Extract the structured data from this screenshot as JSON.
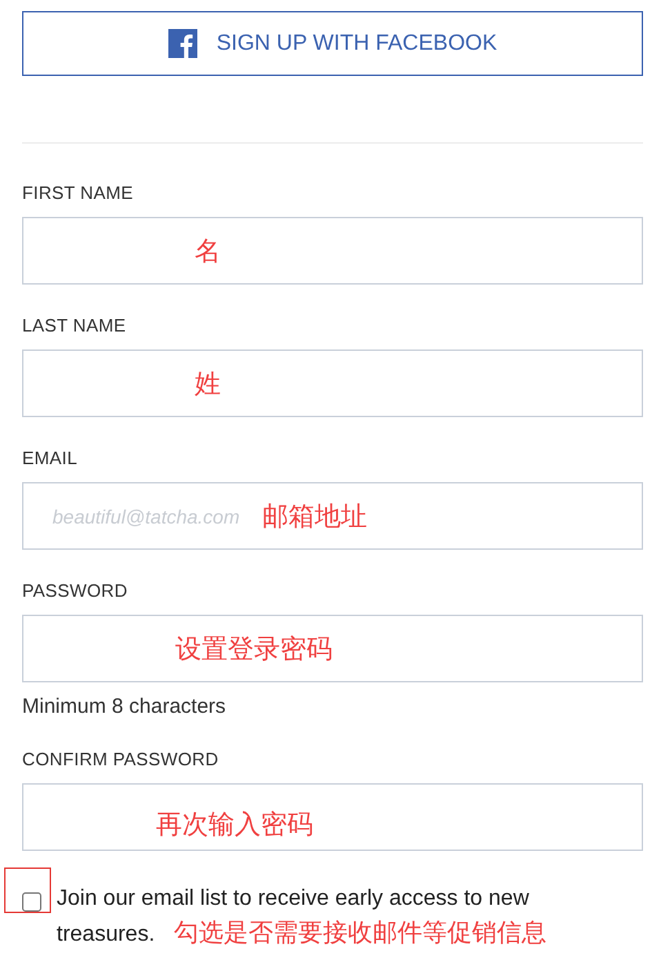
{
  "facebook_button": {
    "label": "SIGN UP WITH FACEBOOK"
  },
  "fields": [
    {
      "label": "FIRST NAME",
      "annotation": "名"
    },
    {
      "label": "LAST NAME",
      "annotation": "姓"
    },
    {
      "label": "EMAIL",
      "placeholder": "beautiful@tatcha.com",
      "annotation": "邮箱地址"
    },
    {
      "label": "PASSWORD",
      "annotation": "设置登录密码",
      "hint": "Minimum 8 characters"
    },
    {
      "label": "CONFIRM PASSWORD",
      "annotation": "再次输入密码"
    }
  ],
  "newsletter": {
    "label_lines": [
      "Join our email list to receive early access to new",
      "treasures."
    ],
    "checked": false,
    "annotation": "勾选是否需要接收邮件等促销信息"
  }
}
